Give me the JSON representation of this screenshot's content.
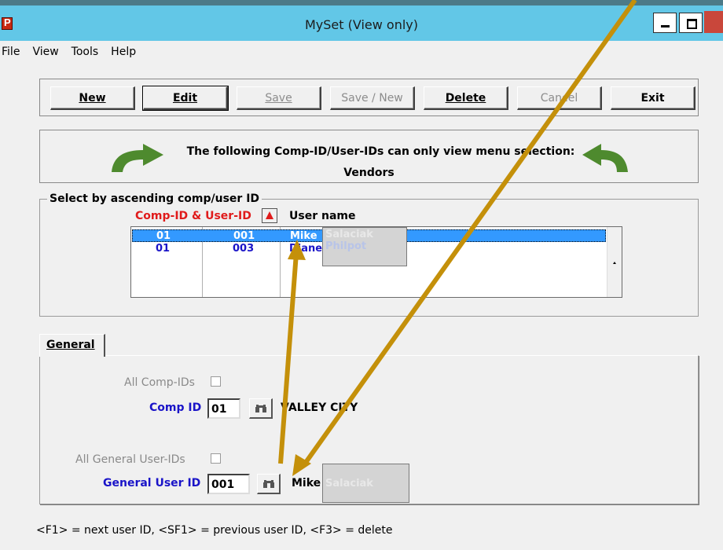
{
  "window": {
    "title": "MySet (View only)",
    "app_icon_letter": "P"
  },
  "menu": [
    "File",
    "View",
    "Tools",
    "Help"
  ],
  "toolbar": {
    "new": "New",
    "edit": "Edit",
    "save": "Save",
    "save_new": "Save / New",
    "delete": "Delete",
    "cancel": "Cancel",
    "exit": "Exit"
  },
  "banner": {
    "line1": "The following Comp-ID/User-IDs can only view menu selection:",
    "line2": "Vendors"
  },
  "list": {
    "group_title": "Select by ascending comp/user ID",
    "col_comp_user": "Comp-ID & User-ID",
    "col_user_name": "User name",
    "rows": [
      {
        "comp": "01",
        "user": "001",
        "name": "Mike",
        "name_hidden": "Salaciak"
      },
      {
        "comp": "01",
        "user": "003",
        "name": "Diane",
        "name_hidden": "Philpot"
      }
    ]
  },
  "tabs": {
    "general": "General"
  },
  "general": {
    "all_comp_ids_label": "All Comp-IDs",
    "comp_id_label": "Comp ID",
    "comp_id_value": "01",
    "comp_name": "VALLEY CITY",
    "all_general_user_ids_label": "All General User-IDs",
    "general_user_id_label": "General User ID",
    "general_user_id_value": "001",
    "user_name": "Mike",
    "user_name_hidden": "Salaciak"
  },
  "status": "<F1> = next user ID, <SF1> = previous user ID, <F3> = delete",
  "colors": {
    "titlebar": "#62c7e7",
    "selection": "#3399ff",
    "blue_label": "#1a14c8",
    "red_header": "#e01b1b",
    "annotation_arrow": "#c4900a",
    "green_arrow": "#4e8a2e"
  }
}
